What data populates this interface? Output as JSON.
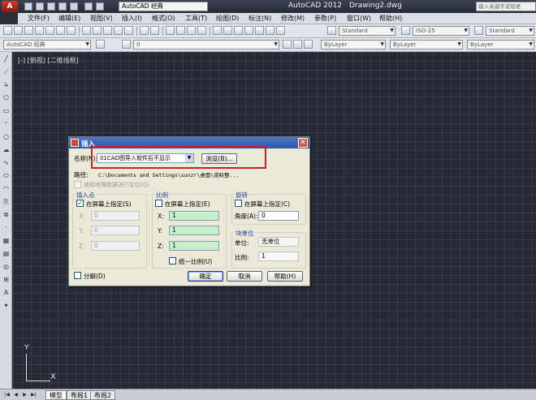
{
  "app": {
    "logo": "A",
    "workspace": "AutoCAD 经典",
    "app_title": "AutoCAD 2012",
    "doc_title": "Drawing2.dwg",
    "search_placeholder": "键入关键字或短语"
  },
  "menu": [
    "文件(F)",
    "编辑(E)",
    "视图(V)",
    "插入(I)",
    "格式(O)",
    "工具(T)",
    "绘图(D)",
    "标注(N)",
    "修改(M)",
    "参数(P)",
    "窗口(W)",
    "帮助(H)"
  ],
  "toolbar1": {
    "text_style": "Standard",
    "dim_style": "ISO-25",
    "table_style": "Standard"
  },
  "toolbar2": {
    "workspace": "AutoCAD 经典",
    "layer": "0",
    "color": "ByLayer",
    "linetype": "ByLayer",
    "lineweight": "ByLayer"
  },
  "viewport_label": "[-] [俯视] [二维线框]",
  "ucs": {
    "y": "Y",
    "x": "X"
  },
  "layout_tabs": [
    "模型",
    "布局1",
    "布局2"
  ],
  "dialog": {
    "title": "插入",
    "close": "✕",
    "name_label": "名称(N):",
    "name_value": "01CAD图导入软件后不显示",
    "browse_label": "浏览(B)...",
    "path_label": "路径:",
    "path_value": "C:\\Documents and Settings\\sunzr\\桌面\\资料整...",
    "geo_label": "使用地理数据进行定位(G)",
    "insertion": {
      "title": "插入点",
      "onscreen_label": "在屏幕上指定(S)",
      "x_label": "X:",
      "x_value": "0",
      "y_label": "Y:",
      "y_value": "0",
      "z_label": "Z:",
      "z_value": "0"
    },
    "scale": {
      "title": "比例",
      "onscreen_label": "在屏幕上指定(E)",
      "x_label": "X:",
      "x_value": "1",
      "y_label": "Y:",
      "y_value": "1",
      "z_label": "Z:",
      "z_value": "1",
      "uniform_label": "统一比例(U)"
    },
    "rotation": {
      "title": "旋转",
      "onscreen_label": "在屏幕上指定(C)",
      "angle_label": "角度(A):",
      "angle_value": "0"
    },
    "unit": {
      "title": "块单位",
      "unit_label": "单位:",
      "unit_value": "无单位",
      "ratio_label": "比例:",
      "ratio_value": "1"
    },
    "explode_label": "分解(D)",
    "ok_label": "确定",
    "cancel_label": "取消",
    "help_label": "帮助(H)"
  }
}
